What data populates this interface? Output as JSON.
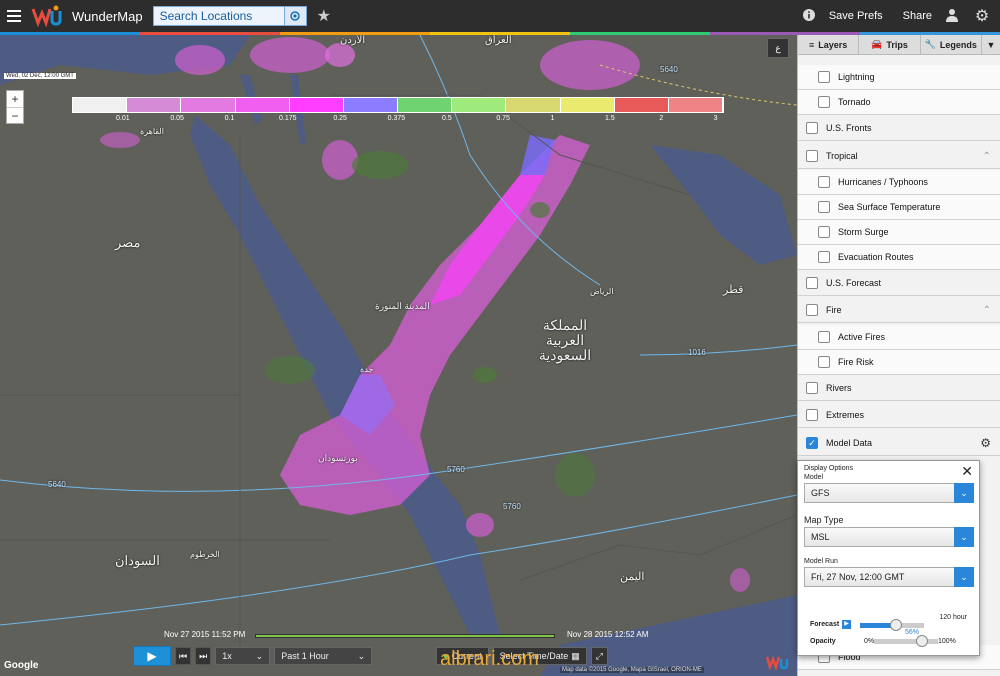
{
  "header": {
    "app_name": "WunderMap",
    "search_placeholder": "Search Locations",
    "save_prefs": "Save Prefs",
    "share": "Share"
  },
  "map": {
    "timestamp": "Wed, 02 Dec, 12:00 GMT",
    "zoom_in": "+",
    "zoom_out": "−",
    "labels": {
      "egypt": "مصر",
      "saudi": "المملكة العربية السعودية",
      "sudan": "السودان",
      "yemen": "اليمن",
      "jordan": "الأردن",
      "iraq": "العراق",
      "qatar": "قطر",
      "riyadh": "الرياض",
      "madinah": "المدينة المنورة",
      "jeddah": "جدة",
      "port_sudan": "بورتسودان",
      "khartoum": "الخرطوم",
      "cairo": "القاهرة"
    },
    "isobars": [
      "5640",
      "5760",
      "1016",
      "5760",
      "5640"
    ],
    "attribution": "Map data ©2015 Google, Mapa GISrael, ORION-ME",
    "watermark": "albrari.com"
  },
  "legend": {
    "ticks": [
      "0.01",
      "0.05",
      "0.1",
      "0.175",
      "0.25",
      "0.375",
      "0.5",
      "0.75",
      "1",
      "1.5",
      "2",
      "3"
    ],
    "colors": [
      "#f0f0f0",
      "#d68bd6",
      "#e27ae2",
      "#f05ff0",
      "#ff3dff",
      "#8c7cff",
      "#6fd46f",
      "#9eea7a",
      "#d8d870",
      "#eaea6e",
      "#e85a5a",
      "#f08484"
    ]
  },
  "panel": {
    "tabs": {
      "layers": "Layers",
      "trips": "Trips",
      "legends": "Legends"
    },
    "rows": [
      {
        "label": "Lightning",
        "sub": true,
        "checked": false
      },
      {
        "label": "Tornado",
        "sub": true,
        "checked": false
      },
      {
        "label": "U.S. Fronts",
        "sub": false,
        "checked": false
      },
      {
        "label": "Tropical",
        "sub": false,
        "checked": false
      },
      {
        "label": "Hurricanes / Typhoons",
        "sub": true,
        "checked": false
      },
      {
        "label": "Sea Surface Temperature",
        "sub": true,
        "checked": false
      },
      {
        "label": "Storm Surge",
        "sub": true,
        "checked": false
      },
      {
        "label": "Evacuation Routes",
        "sub": true,
        "checked": false
      },
      {
        "label": "U.S. Forecast",
        "sub": false,
        "checked": false
      },
      {
        "label": "Fire",
        "sub": false,
        "checked": false
      },
      {
        "label": "Active Fires",
        "sub": true,
        "checked": false
      },
      {
        "label": "Fire Risk",
        "sub": true,
        "checked": false
      },
      {
        "label": "Rivers",
        "sub": false,
        "checked": false
      },
      {
        "label": "Extremes",
        "sub": false,
        "checked": false
      },
      {
        "label": "Model Data",
        "sub": false,
        "checked": true
      }
    ],
    "flood": "Flood"
  },
  "popup": {
    "title": "Display Options",
    "model_label": "Model",
    "model_value": "GFS",
    "map_type_label": "Map Type",
    "map_type_value": "MSL",
    "model_run_label": "Model Run",
    "model_run_value": "Fri, 27 Nov, 12:00 GMT",
    "forecast_label": "Forecast",
    "forecast_max": "120 hour",
    "forecast_pct": "56%",
    "opacity_label": "Opacity",
    "opacity_min": "0%",
    "opacity_max": "100%",
    "forecast_fraction": 0.56,
    "opacity_fraction": 0.75
  },
  "timeline": {
    "start": "Nov 27 2015 11:52 PM",
    "end": "Nov 28 2015 12:52 AM",
    "speed": "1x",
    "range": "Past 1 Hour",
    "current": "Current",
    "select_time": "Select Time/Date"
  }
}
